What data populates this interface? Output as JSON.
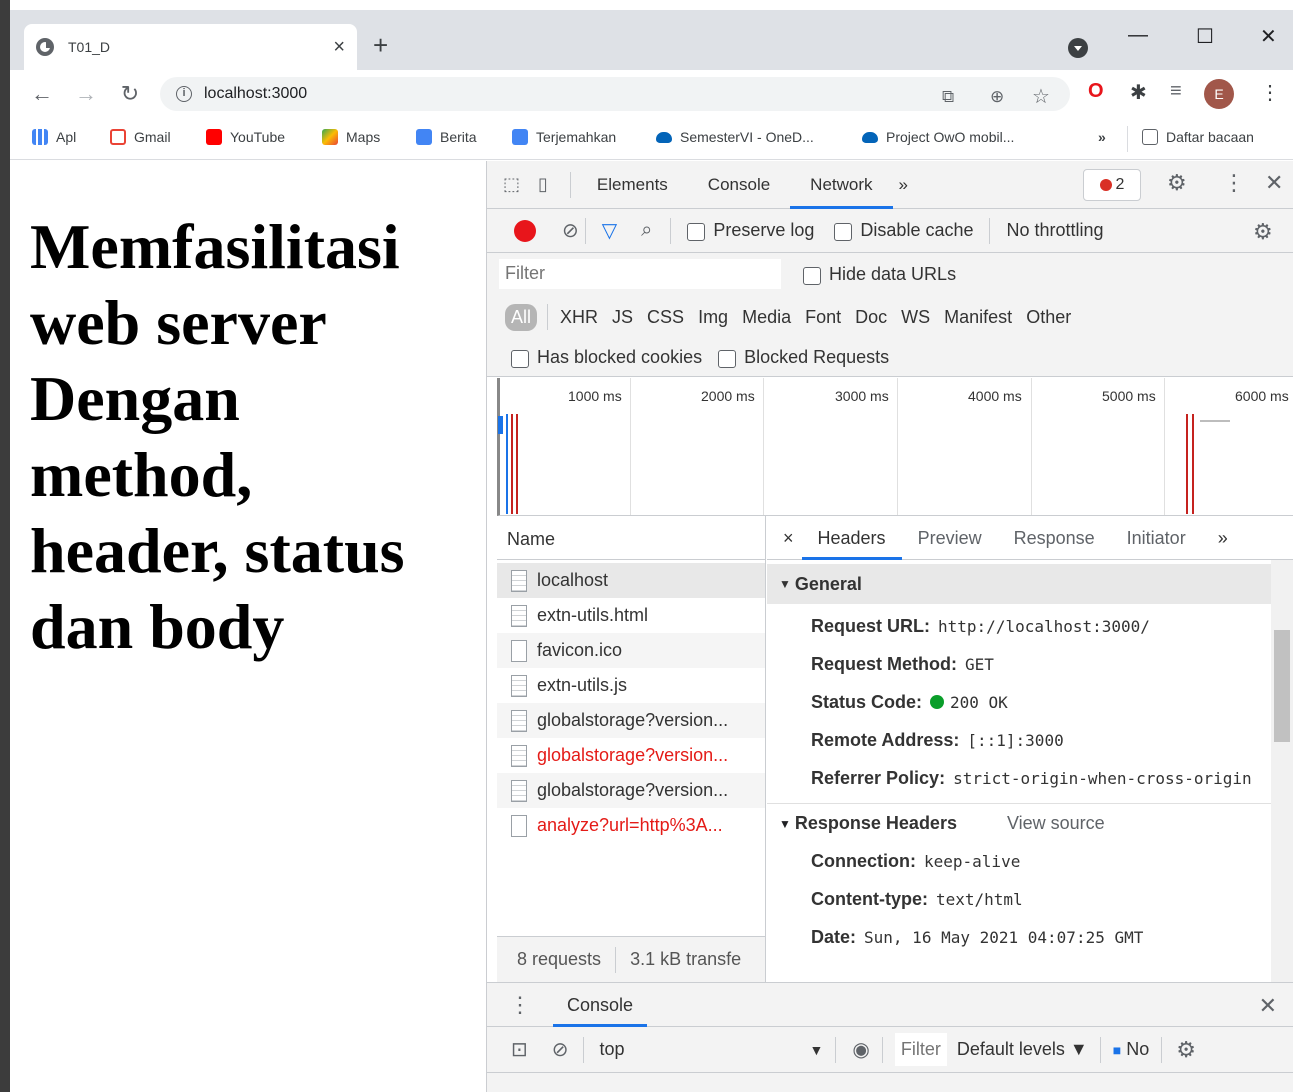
{
  "browser": {
    "tab_title": "T01_D",
    "tab_close": "×",
    "new_tab": "+",
    "url": "localhost:3000",
    "window_controls": {
      "minimize": "—",
      "maximize": "☐",
      "close": "✕"
    },
    "profile_initial": "E"
  },
  "bookmarks": [
    {
      "label": "Apl",
      "color": "#4285f4"
    },
    {
      "label": "Gmail",
      "color": "#ea4335"
    },
    {
      "label": "YouTube",
      "color": "#ff0000"
    },
    {
      "label": "Maps",
      "color": "#34a853"
    },
    {
      "label": "Berita",
      "color": "#4285f4"
    },
    {
      "label": "Terjemahkan",
      "color": "#4285f4"
    },
    {
      "label": "SemesterVI - OneD...",
      "color": "#0364b8"
    },
    {
      "label": "Project OwO mobil...",
      "color": "#0364b8"
    }
  ],
  "bookmarks_more": "»",
  "reading_list": "Daftar bacaan",
  "page": {
    "heading_lines": [
      "Memfasilitasi",
      "web server",
      "Dengan",
      "method,",
      "header, status",
      "dan body"
    ]
  },
  "devtools": {
    "tabs": [
      "Elements",
      "Console",
      "Network"
    ],
    "active_tab": "Network",
    "more": "»",
    "error_count": "2",
    "toolbar": {
      "preserve_log": "Preserve log",
      "disable_cache": "Disable cache",
      "throttling": "No throttling"
    },
    "filter_placeholder": "Filter",
    "hide_data_urls": "Hide data URLs",
    "types": [
      "All",
      "XHR",
      "JS",
      "CSS",
      "Img",
      "Media",
      "Font",
      "Doc",
      "WS",
      "Manifest",
      "Other"
    ],
    "has_blocked_cookies": "Has blocked cookies",
    "blocked_requests": "Blocked Requests",
    "timeline_ticks": [
      "1000 ms",
      "2000 ms",
      "3000 ms",
      "4000 ms",
      "5000 ms",
      "6000 ms"
    ],
    "name_header": "Name",
    "requests": [
      {
        "name": "localhost",
        "error": false
      },
      {
        "name": "extn-utils.html",
        "error": false
      },
      {
        "name": "favicon.ico",
        "error": false
      },
      {
        "name": "extn-utils.js",
        "error": false
      },
      {
        "name": "globalstorage?version...",
        "error": false
      },
      {
        "name": "globalstorage?version...",
        "error": true
      },
      {
        "name": "globalstorage?version...",
        "error": false
      },
      {
        "name": "analyze?url=http%3A...",
        "error": true
      }
    ],
    "summary_requests": "8 requests",
    "summary_transfer": "3.1 kB transfe",
    "detail_tabs": [
      "Headers",
      "Preview",
      "Response",
      "Initiator"
    ],
    "detail_close": "×",
    "detail_more": "»",
    "general_title": "General",
    "general": [
      {
        "key": "Request URL:",
        "value": "http://localhost:3000/"
      },
      {
        "key": "Request Method:",
        "value": "GET"
      },
      {
        "key": "Status Code:",
        "value": "200 OK"
      },
      {
        "key": "Remote Address:",
        "value": "[::1]:3000"
      },
      {
        "key": "Referrer Policy:",
        "value": "strict-origin-when-cross-origin"
      }
    ],
    "response_headers_title": "Response Headers",
    "view_source": "View source",
    "response_headers": [
      {
        "key": "Connection:",
        "value": "keep-alive"
      },
      {
        "key": "Content-type:",
        "value": "text/html"
      },
      {
        "key": "Date:",
        "value": "Sun, 16 May 2021 04:07:25 GMT"
      }
    ],
    "drawer": {
      "title": "Console",
      "context": "top",
      "filter": "Filter",
      "levels": "Default levels ▼",
      "issues": "No"
    }
  },
  "colors": {
    "accent": "#1a73e8",
    "error": "#e41b17",
    "status_ok": "#0a9e2a",
    "record": "#e8151b"
  }
}
